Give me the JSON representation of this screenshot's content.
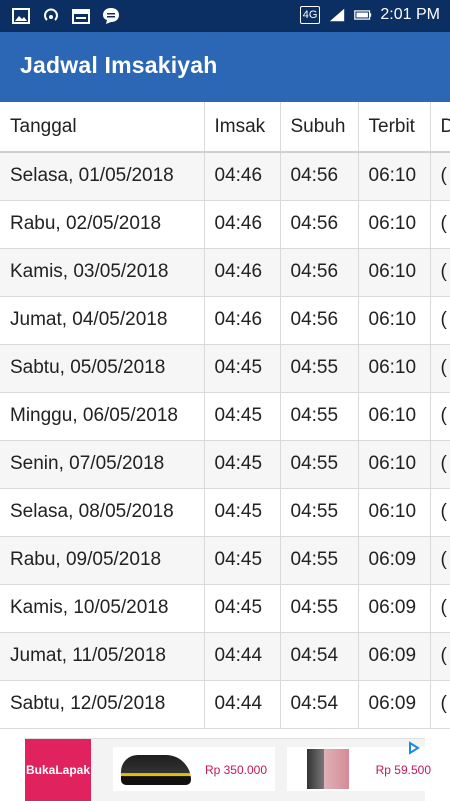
{
  "status_bar": {
    "network": "4G",
    "time": "2:01 PM",
    "icons": [
      "image-icon",
      "hotspot-icon",
      "calendar-icon",
      "chat-icon",
      "signal-icon",
      "battery-icon"
    ]
  },
  "app_bar": {
    "title": "Jadwal Imsakiyah"
  },
  "table": {
    "headers": [
      "Tanggal",
      "Imsak",
      "Subuh",
      "Terbit",
      "D"
    ],
    "rows": [
      {
        "tanggal": "Selasa, 01/05/2018",
        "imsak": "04:46",
        "subuh": "04:56",
        "terbit": "06:10",
        "next": "("
      },
      {
        "tanggal": "Rabu, 02/05/2018",
        "imsak": "04:46",
        "subuh": "04:56",
        "terbit": "06:10",
        "next": "("
      },
      {
        "tanggal": "Kamis, 03/05/2018",
        "imsak": "04:46",
        "subuh": "04:56",
        "terbit": "06:10",
        "next": "("
      },
      {
        "tanggal": "Jumat, 04/05/2018",
        "imsak": "04:46",
        "subuh": "04:56",
        "terbit": "06:10",
        "next": "("
      },
      {
        "tanggal": "Sabtu, 05/05/2018",
        "imsak": "04:45",
        "subuh": "04:55",
        "terbit": "06:10",
        "next": "("
      },
      {
        "tanggal": "Minggu, 06/05/2018",
        "imsak": "04:45",
        "subuh": "04:55",
        "terbit": "06:10",
        "next": "("
      },
      {
        "tanggal": "Senin, 07/05/2018",
        "imsak": "04:45",
        "subuh": "04:55",
        "terbit": "06:10",
        "next": "("
      },
      {
        "tanggal": "Selasa, 08/05/2018",
        "imsak": "04:45",
        "subuh": "04:55",
        "terbit": "06:10",
        "next": "("
      },
      {
        "tanggal": "Rabu, 09/05/2018",
        "imsak": "04:45",
        "subuh": "04:55",
        "terbit": "06:09",
        "next": "("
      },
      {
        "tanggal": "Kamis, 10/05/2018",
        "imsak": "04:45",
        "subuh": "04:55",
        "terbit": "06:09",
        "next": "("
      },
      {
        "tanggal": "Jumat, 11/05/2018",
        "imsak": "04:44",
        "subuh": "04:54",
        "terbit": "06:09",
        "next": "("
      },
      {
        "tanggal": "Sabtu, 12/05/2018",
        "imsak": "04:44",
        "subuh": "04:54",
        "terbit": "06:09",
        "next": "("
      }
    ]
  },
  "ad": {
    "brand": "BukaLapak",
    "product_one_price": "Rp 350.000",
    "product_two_price": "Rp 59.500"
  },
  "colors": {
    "status_bar": "#0b2f62",
    "app_bar": "#2b67b5",
    "ad_brand": "#e0225f"
  }
}
